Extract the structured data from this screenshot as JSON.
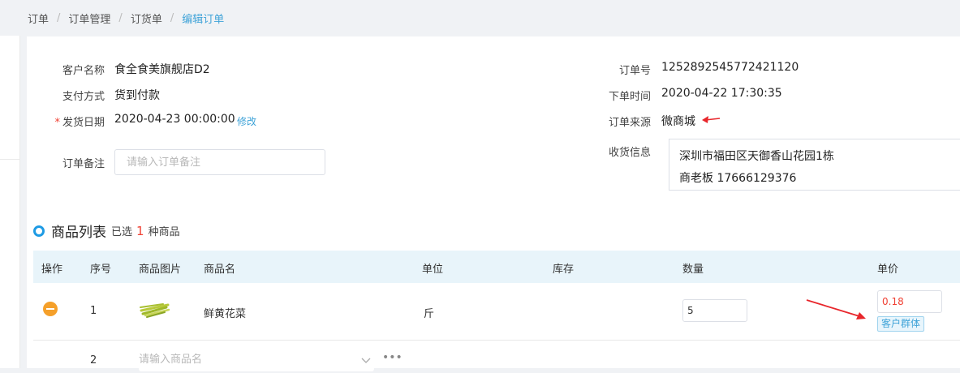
{
  "breadcrumb": [
    "订单",
    "订单管理",
    "订货单",
    "编辑订单"
  ],
  "order": {
    "customer_label": "客户名称",
    "customer_value": "食全食美旗舰店D2",
    "payment_label": "支付方式",
    "payment_value": "货到付款",
    "ship_date_label": "发货日期",
    "ship_date_value": "2020-04-23 00:00:00",
    "modify_link": "修改",
    "remark_label": "订单备注",
    "remark_placeholder": "请输入订单备注",
    "order_no_label": "订单号",
    "order_no_value": "1252892545772421120",
    "order_time_label": "下单时间",
    "order_time_value": "2020-04-22 17:30:35",
    "source_label": "订单来源",
    "source_value": "微商城",
    "shipping_label": "收货信息",
    "shipping_address": "深圳市福田区天御香山花园1栋",
    "shipping_contact": "商老板 17666129376"
  },
  "product_list": {
    "title": "商品列表",
    "selected_prefix": "已选",
    "selected_count": "1",
    "selected_suffix": "种商品",
    "columns": [
      "操作",
      "序号",
      "商品图片",
      "商品名",
      "单位",
      "库存",
      "数量",
      "单价"
    ],
    "rows": [
      {
        "index": "1",
        "name": "鲜黄花菜",
        "unit": "斤",
        "stock": "",
        "quantity": "5",
        "price": "0.18",
        "tag": "客户群体"
      }
    ],
    "new_row": {
      "index": "2",
      "name_placeholder": "请输入商品名"
    }
  },
  "colors": {
    "accent": "#3fa3d8",
    "danger": "#f04134",
    "header_bg": "#e8f4fa",
    "remove": "#f5a02a"
  }
}
